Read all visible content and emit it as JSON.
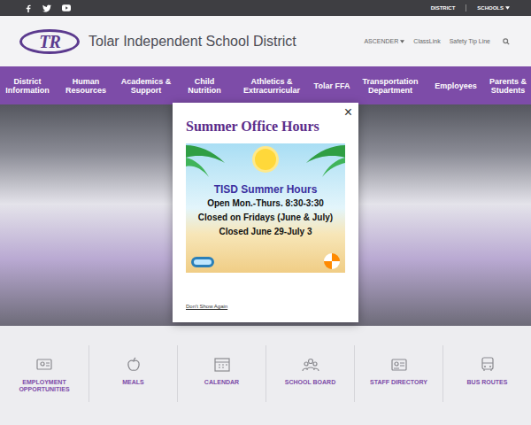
{
  "top_bar": {
    "links": [
      {
        "label": "DISTRICT",
        "has_menu": false
      },
      {
        "label": "SCHOOLS",
        "has_menu": true
      }
    ]
  },
  "header": {
    "logo": "TR",
    "title": "Tolar Independent School District",
    "links": [
      {
        "label": "ASCENDER",
        "has_menu": true
      },
      {
        "label": "ClassLink",
        "has_menu": false
      },
      {
        "label": "Safety Tip Line",
        "has_menu": false
      }
    ]
  },
  "nav": [
    "District Information",
    "Human Resources",
    "Academics & Support",
    "Child Nutrition",
    "Athletics & Extracurricular",
    "Tolar FFA",
    "Transportation Department",
    "Employees",
    "Parents & Students"
  ],
  "modal": {
    "title": "Summer Office Hours",
    "close": "×",
    "banner": {
      "heading": "TISD Summer Hours",
      "lines": [
        "Open Mon.-Thurs. 8:30-3:30",
        "Closed on Fridays (June & July)",
        "Closed June 29-July 3"
      ]
    },
    "dismiss": "Don't Show Again"
  },
  "quick_links": [
    "EMPLOYMENT OPPORTUNITIES",
    "MEALS",
    "CALENDAR",
    "SCHOOL BOARD",
    "STAFF DIRECTORY",
    "BUS ROUTES"
  ]
}
